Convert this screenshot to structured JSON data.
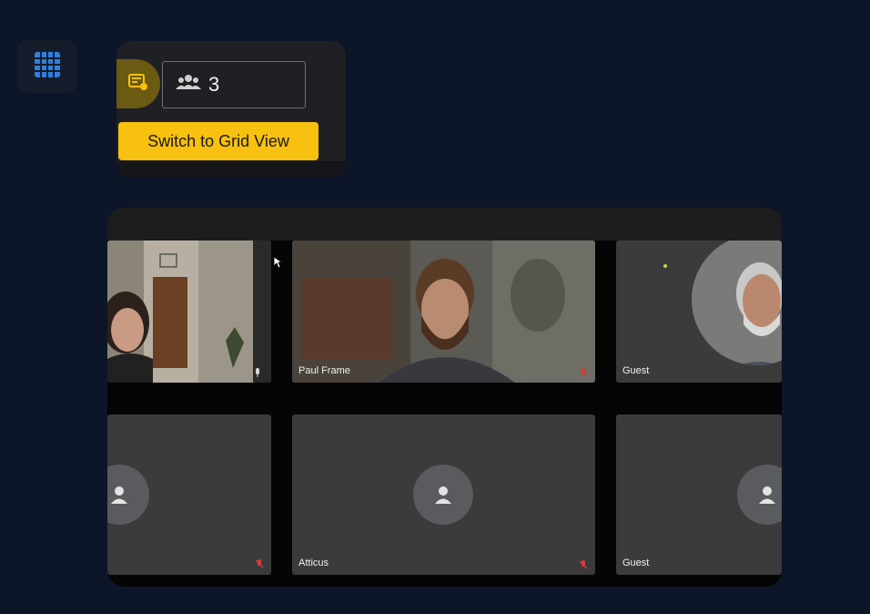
{
  "sidebar": {
    "grid_icon": "grid-icon"
  },
  "toolbar": {
    "layout_icon": "layout-icon",
    "participants_icon": "people-icon",
    "participant_count": "3",
    "tooltip": "Switch to Grid View"
  },
  "tiles": [
    {
      "name": "",
      "video": true,
      "mic_muted": false
    },
    {
      "name": "Paul Frame",
      "video": true,
      "mic_muted": true
    },
    {
      "name": "Guest",
      "video": true,
      "mic_muted": false
    },
    {
      "name": "",
      "video": false,
      "mic_muted": true
    },
    {
      "name": "Atticus",
      "video": false,
      "mic_muted": true
    },
    {
      "name": "Guest",
      "video": false,
      "mic_muted": false
    }
  ],
  "colors": {
    "background": "#0c1628",
    "accent_yellow": "#f8c00f",
    "grid_icon_blue": "#2f7fe0",
    "muted_red": "#d23b3b"
  }
}
